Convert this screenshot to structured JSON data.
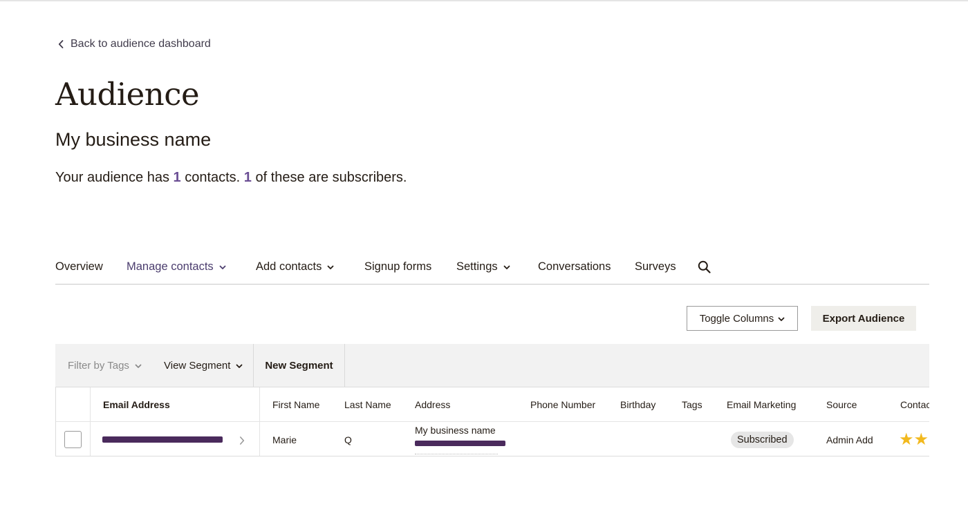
{
  "back_link": {
    "label": "Back to audience dashboard",
    "icon": "chevron-left-icon"
  },
  "page_title": "Audience",
  "business_name": "My business name",
  "summary": {
    "prefix": "Your audience has ",
    "contacts_count": "1",
    "middle": " contacts. ",
    "subscribers_count": "1",
    "suffix": " of these are subscribers."
  },
  "nav": {
    "items": [
      {
        "label": "Overview",
        "has_dropdown": false,
        "active": false
      },
      {
        "label": "Manage contacts",
        "has_dropdown": true,
        "active": true
      },
      {
        "label": "Add contacts",
        "has_dropdown": true,
        "active": false
      },
      {
        "label": "Signup forms",
        "has_dropdown": false,
        "active": false
      },
      {
        "label": "Settings",
        "has_dropdown": true,
        "active": false
      },
      {
        "label": "Conversations",
        "has_dropdown": false,
        "active": false
      },
      {
        "label": "Surveys",
        "has_dropdown": false,
        "active": false
      }
    ],
    "search_icon": "search-icon"
  },
  "actions": {
    "toggle_columns": "Toggle Columns",
    "export_audience": "Export Audience"
  },
  "filters": {
    "filter_by_tags": "Filter by Tags",
    "view_segment": "View Segment",
    "new_segment": "New Segment"
  },
  "table": {
    "columns": [
      "Email Address",
      "First Name",
      "Last Name",
      "Address",
      "Phone Number",
      "Birthday",
      "Tags",
      "Email Marketing",
      "Source",
      "Contac"
    ],
    "rows": [
      {
        "email": "[redacted]",
        "first_name": "Marie",
        "last_name": "Q",
        "address_line1": "My business name",
        "address_line2": "[redacted]",
        "phone_number": "",
        "birthday": "",
        "tags": "",
        "email_marketing": "Subscribed",
        "source": "Admin Add",
        "contact_rating_stars": 2
      }
    ]
  },
  "colors": {
    "accent_purple": "#6b4e94",
    "active_nav": "#4b3d6e",
    "star": "#f2b91e",
    "redaction": "#4a2a5c",
    "filter_bar_bg": "#f2f2f2"
  }
}
